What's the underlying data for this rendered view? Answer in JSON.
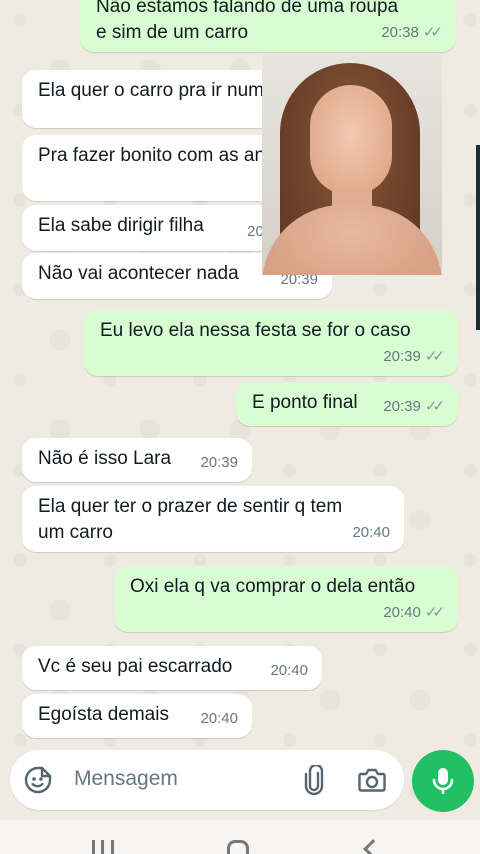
{
  "messages": [
    {
      "dir": "out",
      "text": "Não estamos falando de uma roupa\ne sim de um carro",
      "time": "20:38",
      "read": true
    },
    {
      "dir": "in",
      "text": "Ela quer o carro pra ir numa fe",
      "time": ""
    },
    {
      "dir": "in",
      "text": "Pra fazer bonito com as an",
      "time": ""
    },
    {
      "dir": "in",
      "text": "Ela sabe dirigir filha",
      "time": "20:"
    },
    {
      "dir": "in",
      "text": "Não vai acontecer nada",
      "time": "20:39"
    },
    {
      "dir": "out",
      "text": "Eu levo ela nessa festa se for o caso",
      "time": "20:39",
      "read": true
    },
    {
      "dir": "out",
      "text": "E ponto final",
      "time": "20:39",
      "read": true
    },
    {
      "dir": "in",
      "text": "Não é isso Lara",
      "time": "20:39"
    },
    {
      "dir": "in",
      "text": "Ela quer ter o prazer de sentir q tem\num carro",
      "time": "20:40"
    },
    {
      "dir": "out",
      "text": "Oxi ela q va comprar o dela então",
      "time": "20:40",
      "read": true
    },
    {
      "dir": "in",
      "text": "Vc é seu pai escarrado",
      "time": "20:40"
    },
    {
      "dir": "in",
      "text": "Egoísta demais",
      "time": "20:40"
    }
  ],
  "composer": {
    "placeholder": "Mensagem",
    "icons": [
      "emoji-sticker-icon",
      "attach-clip-icon",
      "camera-icon",
      "microphone-icon"
    ]
  },
  "colors": {
    "incoming": "#ffffff",
    "outgoing": "#d9fdd3",
    "accent": "#21c063",
    "background": "#efeae2"
  }
}
